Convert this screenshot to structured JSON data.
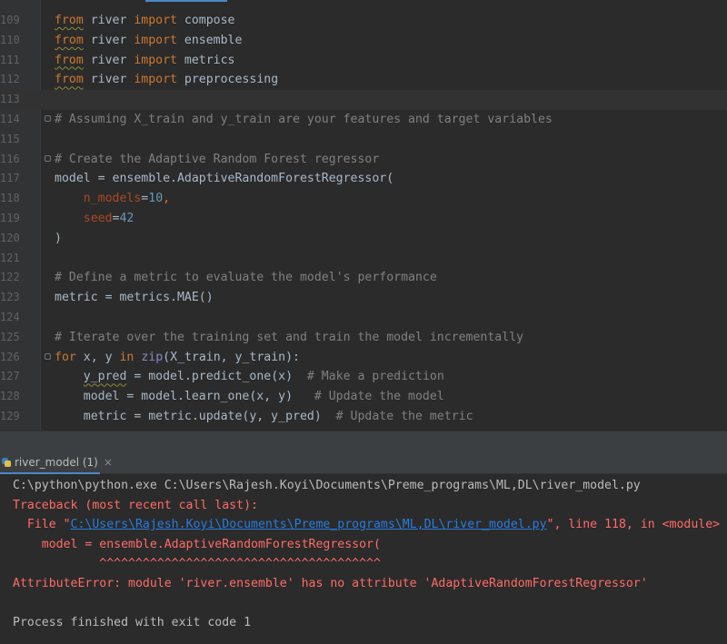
{
  "editor": {
    "lines": [
      {
        "num": "109",
        "parts": [
          {
            "t": "from",
            "c": "kw squig"
          },
          {
            "t": " river ",
            "c": ""
          },
          {
            "t": "import",
            "c": "kw"
          },
          {
            "t": " compose",
            "c": ""
          }
        ]
      },
      {
        "num": "110",
        "parts": [
          {
            "t": "from",
            "c": "kw squig"
          },
          {
            "t": " river ",
            "c": ""
          },
          {
            "t": "import",
            "c": "kw"
          },
          {
            "t": " ensemble",
            "c": ""
          }
        ]
      },
      {
        "num": "111",
        "parts": [
          {
            "t": "from",
            "c": "kw squig"
          },
          {
            "t": " river ",
            "c": ""
          },
          {
            "t": "import",
            "c": "kw"
          },
          {
            "t": " metrics",
            "c": ""
          }
        ]
      },
      {
        "num": "112",
        "parts": [
          {
            "t": "from",
            "c": "kw squig"
          },
          {
            "t": " river ",
            "c": ""
          },
          {
            "t": "import",
            "c": "kw"
          },
          {
            "t": " preprocessing",
            "c": ""
          }
        ]
      },
      {
        "num": "113",
        "current": true,
        "parts": []
      },
      {
        "num": "114",
        "fold": true,
        "parts": [
          {
            "t": "# Assuming X_train and y_train are your features and target variables",
            "c": "cm"
          }
        ]
      },
      {
        "num": "115",
        "parts": []
      },
      {
        "num": "116",
        "fold": true,
        "parts": [
          {
            "t": "# Create the Adaptive Random Forest regressor",
            "c": "cm"
          }
        ]
      },
      {
        "num": "117",
        "parts": [
          {
            "t": "model = ensemble.AdaptiveRandomForestRegressor(",
            "c": ""
          }
        ]
      },
      {
        "num": "118",
        "parts": [
          {
            "t": "    ",
            "c": ""
          },
          {
            "t": "n_models",
            "c": "prm"
          },
          {
            "t": "=",
            "c": ""
          },
          {
            "t": "10",
            "c": "num"
          },
          {
            "t": ",",
            "c": "kw"
          }
        ]
      },
      {
        "num": "119",
        "parts": [
          {
            "t": "    ",
            "c": ""
          },
          {
            "t": "seed",
            "c": "prm"
          },
          {
            "t": "=",
            "c": ""
          },
          {
            "t": "42",
            "c": "num"
          }
        ]
      },
      {
        "num": "120",
        "parts": [
          {
            "t": ")",
            "c": ""
          }
        ]
      },
      {
        "num": "121",
        "parts": []
      },
      {
        "num": "122",
        "parts": [
          {
            "t": "# Define a metric to evaluate the model's performance",
            "c": "cm"
          }
        ]
      },
      {
        "num": "123",
        "parts": [
          {
            "t": "metric = metrics.MAE()",
            "c": ""
          }
        ]
      },
      {
        "num": "124",
        "parts": []
      },
      {
        "num": "125",
        "parts": [
          {
            "t": "# Iterate over the training set and train the model incrementally",
            "c": "cm"
          }
        ]
      },
      {
        "num": "126",
        "fold": true,
        "parts": [
          {
            "t": "for",
            "c": "kw"
          },
          {
            "t": " x, y ",
            "c": ""
          },
          {
            "t": "in",
            "c": "kw"
          },
          {
            "t": " ",
            "c": ""
          },
          {
            "t": "zip",
            "c": "bi"
          },
          {
            "t": "(X_train, y_train):",
            "c": ""
          }
        ]
      },
      {
        "num": "127",
        "parts": [
          {
            "t": "    ",
            "c": ""
          },
          {
            "t": "y_pred",
            "c": "squig"
          },
          {
            "t": " = model.predict_one(x)  ",
            "c": ""
          },
          {
            "t": "# Make a prediction",
            "c": "cm"
          }
        ]
      },
      {
        "num": "128",
        "parts": [
          {
            "t": "    model = model.learn_one(x, y)   ",
            "c": ""
          },
          {
            "t": "# Update the model",
            "c": "cm"
          }
        ]
      },
      {
        "num": "129",
        "parts": [
          {
            "t": "    metric = metric.update(y, y_pred)  ",
            "c": ""
          },
          {
            "t": "# Update the metric",
            "c": "cm"
          }
        ]
      }
    ]
  },
  "run_panel": {
    "tab_label": "river_model (1)",
    "close_glyph": "×",
    "console_lines": [
      {
        "parts": [
          {
            "t": "C:\\python\\python.exe C:\\Users\\Rajesh.Koyi\\Documents\\Preme_programs\\ML,DL\\river_model.py",
            "c": "c-cmd"
          }
        ]
      },
      {
        "parts": [
          {
            "t": "Traceback (most recent call last):",
            "c": "c-err"
          }
        ]
      },
      {
        "parts": [
          {
            "t": "  File \"",
            "c": "c-err"
          },
          {
            "t": "C:\\Users\\Rajesh.Koyi\\Documents\\Preme_programs\\ML,DL\\river_model.py",
            "c": "c-link"
          },
          {
            "t": "\", line 118, in <module>",
            "c": "c-err"
          }
        ]
      },
      {
        "parts": [
          {
            "t": "    model = ensemble.AdaptiveRandomForestRegressor(",
            "c": "c-err"
          }
        ]
      },
      {
        "parts": [
          {
            "t": "            ^^^^^^^^^^^^^^^^^^^^^^^^^^^^^^^^^^^^^^^",
            "c": "c-err"
          }
        ]
      },
      {
        "parts": [
          {
            "t": "AttributeError: module 'river.ensemble' has no attribute 'AdaptiveRandomForestRegressor'",
            "c": "c-err"
          }
        ]
      },
      {
        "parts": []
      },
      {
        "parts": [
          {
            "t": "Process finished with exit code 1",
            "c": "c-out"
          }
        ]
      }
    ]
  },
  "colors": {
    "editor_bg": "#2b2b2b",
    "keyword": "#cc7832",
    "comment": "#808080",
    "number": "#6897bb",
    "param": "#aa4926",
    "error": "#ff6b68",
    "link": "#287bde"
  },
  "icons": {
    "run_tab": "python-file-icon",
    "tab_close": "close-icon",
    "fold": "fold-marker-icon"
  }
}
